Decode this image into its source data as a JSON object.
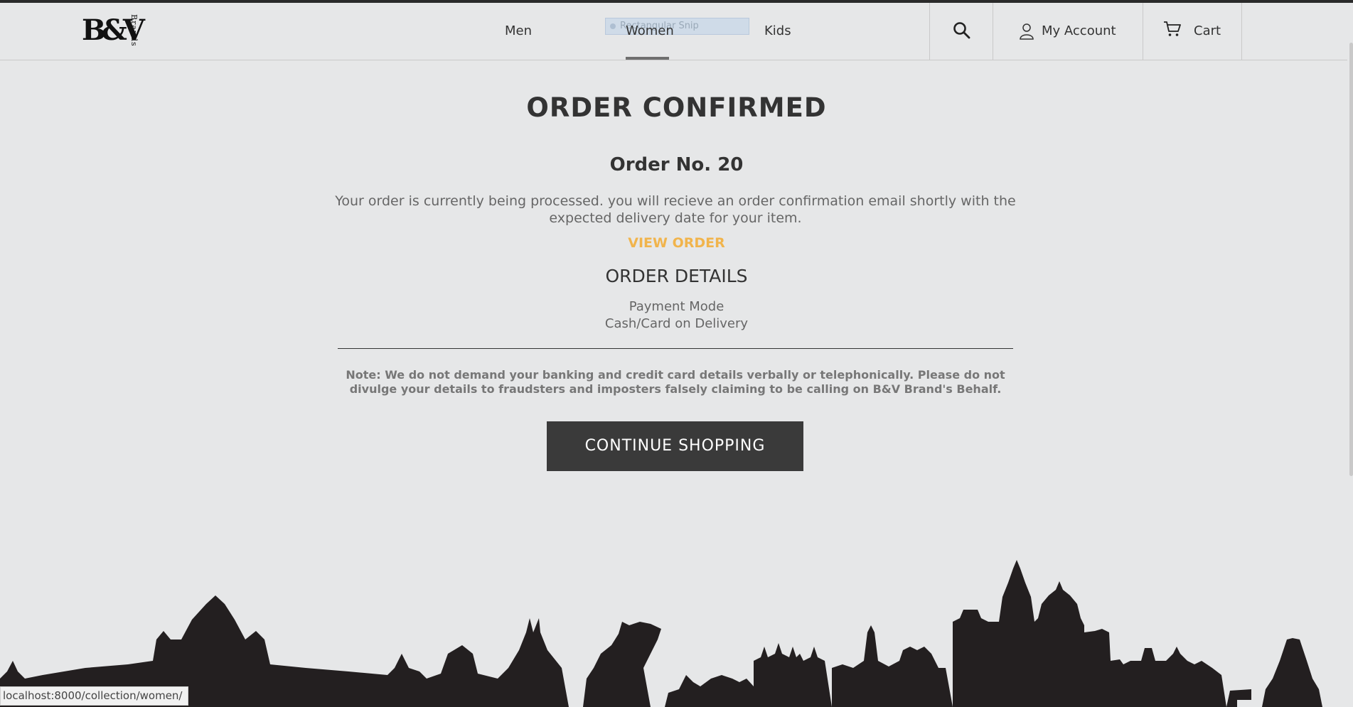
{
  "header": {
    "logo": {
      "main": "B&V",
      "side": "Brands"
    },
    "nav": [
      "Men",
      "Women",
      "Kids"
    ],
    "snip_label": "Rectangular Snip",
    "account_label": "My Account",
    "cart_label": "Cart"
  },
  "main": {
    "title": "ORDER CONFIRMED",
    "order_no": "Order No. 20",
    "message": "Your order is currently being processed. you will recieve an order confirmation email shortly with the expected delivery date for your item.",
    "view_order": "VIEW ORDER",
    "details_title": "ORDER DETAILS",
    "payment_mode_label": "Payment Mode",
    "payment_mode_value": "Cash/Card on Delivery",
    "note": "Note: We do not demand your banking and credit card details verbally or telephonically. Please do not divulge your details to fraudsters and imposters falsely claiming to be calling on B&V Brand's Behalf.",
    "cta": "CONTINUE SHOPPING"
  },
  "status_bar": "localhost:8000/collection/women/",
  "colors": {
    "accent": "#f1b44c",
    "button": "#3a3a3a",
    "background": "#e6e7e8"
  },
  "icons": [
    "search-icon",
    "user-icon",
    "cart-icon"
  ]
}
